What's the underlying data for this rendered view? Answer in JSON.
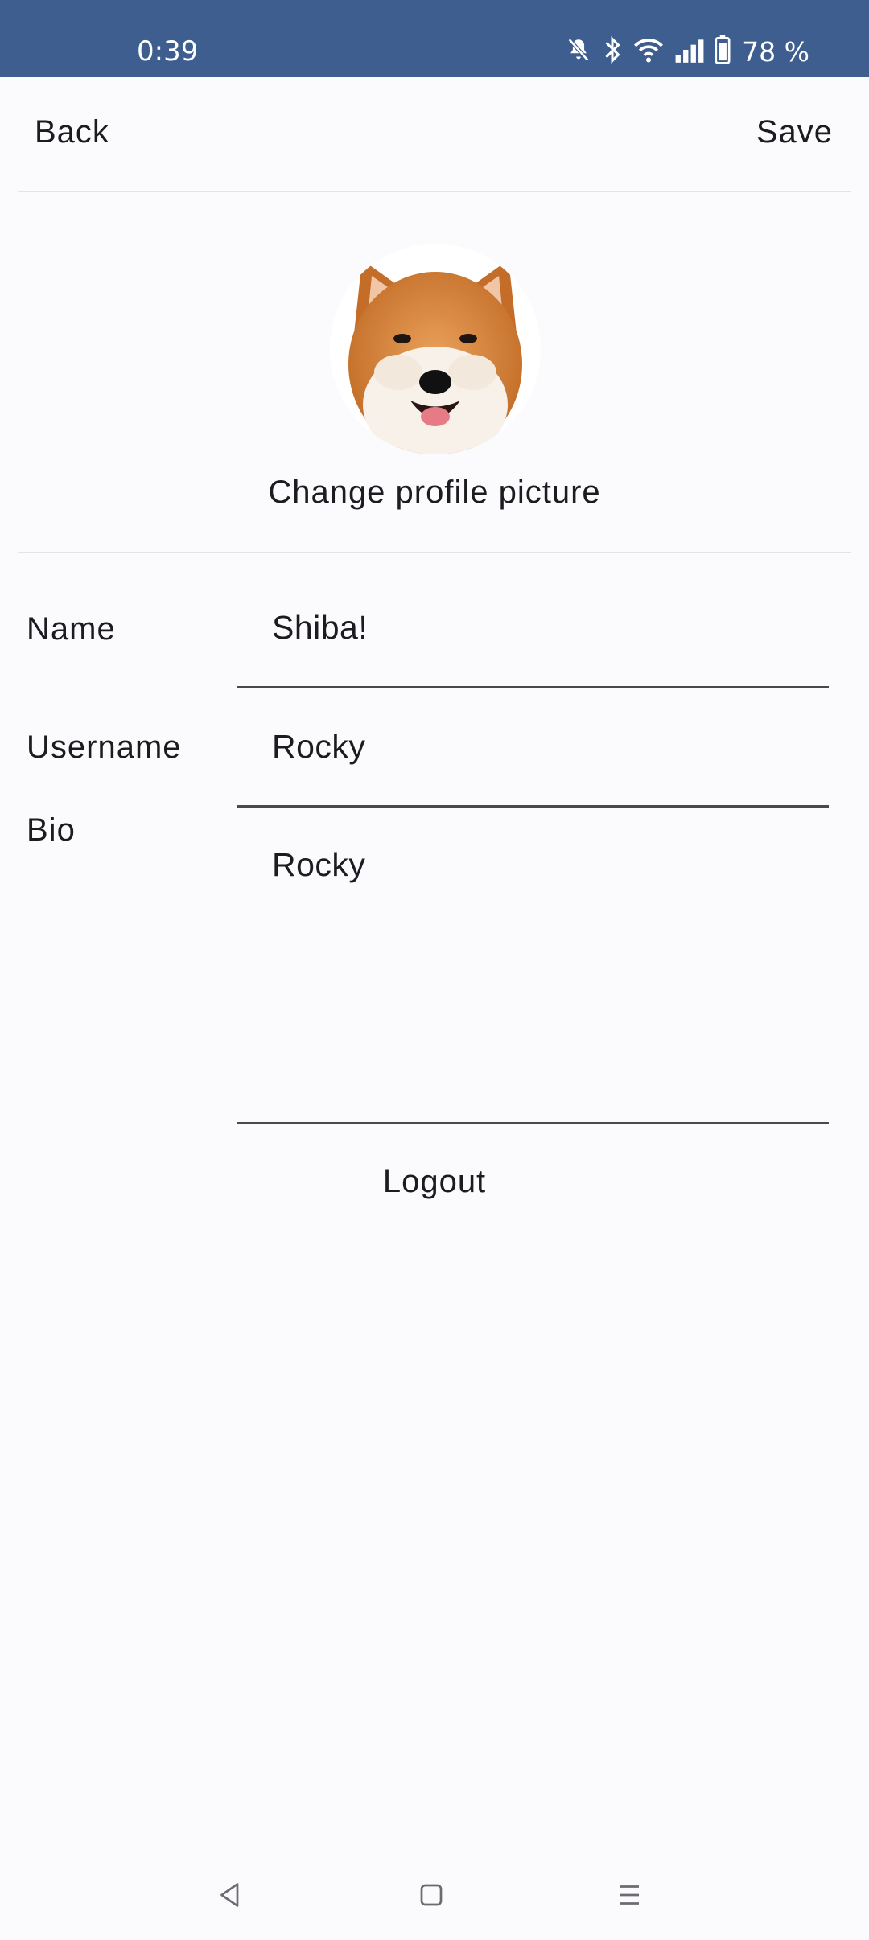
{
  "status_bar": {
    "time": "0:39",
    "battery_percent": "78 %",
    "icons": [
      "mute-icon",
      "bluetooth-icon",
      "wifi-icon",
      "signal-icon",
      "battery-icon"
    ]
  },
  "top_bar": {
    "back_label": "Back",
    "save_label": "Save"
  },
  "profile_picture": {
    "change_label": "Change profile picture"
  },
  "form": {
    "name_label": "Name",
    "name_value": "Shiba!",
    "username_label": "Username",
    "username_value": "Rocky",
    "bio_label": "Bio",
    "bio_value": "Rocky"
  },
  "logout_label": "Logout",
  "nav_bar": {
    "icons": [
      "back-nav-icon",
      "home-nav-icon",
      "recents-nav-icon"
    ]
  },
  "colors": {
    "status_bar_bg": "#3d5e8e",
    "page_bg": "#fbfbfe",
    "text": "#1c1b1f",
    "underline": "#4a4a4e"
  }
}
